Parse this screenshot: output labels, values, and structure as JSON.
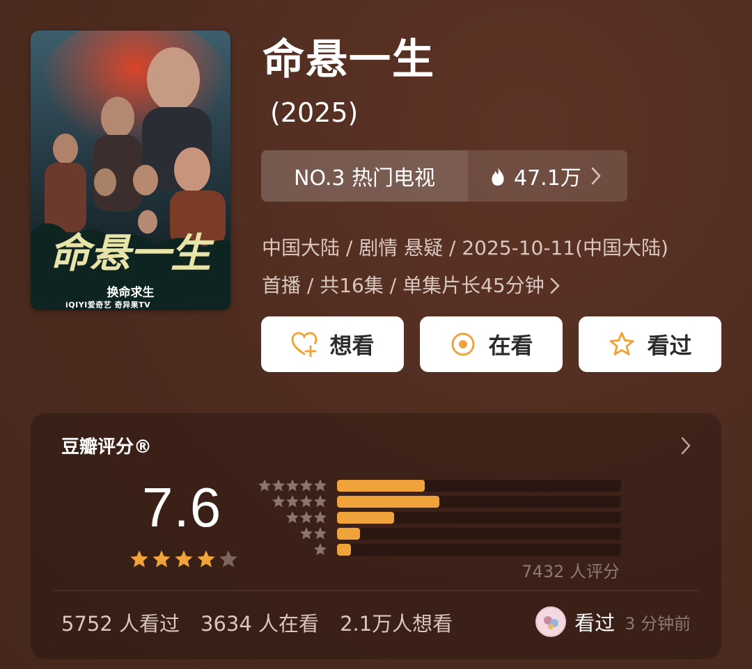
{
  "poster": {
    "calligraphy": "命悬一生",
    "tagline": "换命求生",
    "brand": "iQIYI爱奇艺  奇异果TV"
  },
  "title": "命悬一生",
  "year": "(2025)",
  "rank": {
    "label": "NO.3 热门电视",
    "heat": "47.1万"
  },
  "meta": {
    "line1": "中国大陆 / 剧情 悬疑 / 2025-10-11(中国大陆)",
    "line2": "首播 / 共16集 / 单集片长45分钟"
  },
  "actions": {
    "want": "想看",
    "watching": "在看",
    "watched": "看过"
  },
  "rating": {
    "title": "豆瓣评分®",
    "score": "7.6",
    "stars_out_of_5": 4,
    "distribution_fraction": [
      0.31,
      0.36,
      0.2,
      0.08,
      0.05
    ],
    "count": "7432 人评分",
    "stats": {
      "watched": "5752 人看过",
      "watching": "3634 人在看",
      "want": "2.1万人想看"
    },
    "recent": {
      "label": "看过",
      "time": "3 分钟前"
    }
  },
  "colors": {
    "accent": "#f0a33a",
    "background": "#4f2c20"
  }
}
